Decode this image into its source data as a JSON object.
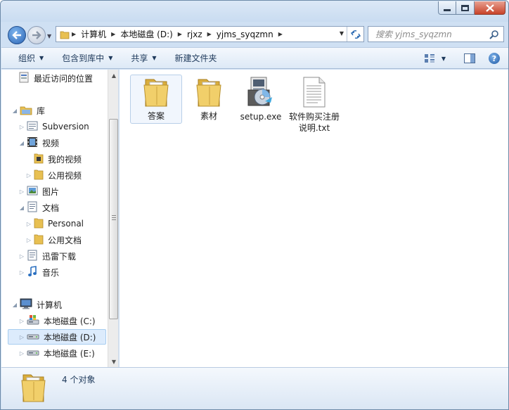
{
  "nav": {
    "breadcrumb": [
      "计算机",
      "本地磁盘 (D:)",
      "rjxz",
      "yjms_syqzmn"
    ],
    "search_placeholder": "搜索 yjms_syqzmn"
  },
  "toolbar": {
    "organize": "组织",
    "include_in_library": "包含到库中",
    "share": "共享",
    "new_folder": "新建文件夹"
  },
  "sidebar": {
    "items": [
      {
        "label": "最近访问的位置",
        "icon": "recent-places-icon"
      },
      {
        "label": "库",
        "icon": "library-icon"
      },
      {
        "label": "Subversion",
        "icon": "document-library-icon"
      },
      {
        "label": "视频",
        "icon": "video-library-icon"
      },
      {
        "label": "我的视频",
        "icon": "folder-icon"
      },
      {
        "label": "公用视频",
        "icon": "folder-icon"
      },
      {
        "label": "图片",
        "icon": "picture-library-icon"
      },
      {
        "label": "文档",
        "icon": "document-library-icon"
      },
      {
        "label": "Personal",
        "icon": "folder-icon"
      },
      {
        "label": "公用文档",
        "icon": "folder-icon"
      },
      {
        "label": "迅雷下载",
        "icon": "document-library-icon"
      },
      {
        "label": "音乐",
        "icon": "music-icon"
      },
      {
        "label": "计算机",
        "icon": "computer-icon"
      },
      {
        "label": "本地磁盘 (C:)",
        "icon": "system-drive-icon"
      },
      {
        "label": "本地磁盘 (D:)",
        "icon": "drive-icon"
      },
      {
        "label": "本地磁盘 (E:)",
        "icon": "drive-icon"
      }
    ]
  },
  "files": [
    {
      "name": "答案",
      "icon": "folder-icon"
    },
    {
      "name": "素材",
      "icon": "folder-icon"
    },
    {
      "name": "setup.exe",
      "icon": "installer-icon"
    },
    {
      "name": "软件购买注册说明.txt",
      "icon": "text-file-icon"
    }
  ],
  "details": {
    "count": "4 个对象"
  }
}
